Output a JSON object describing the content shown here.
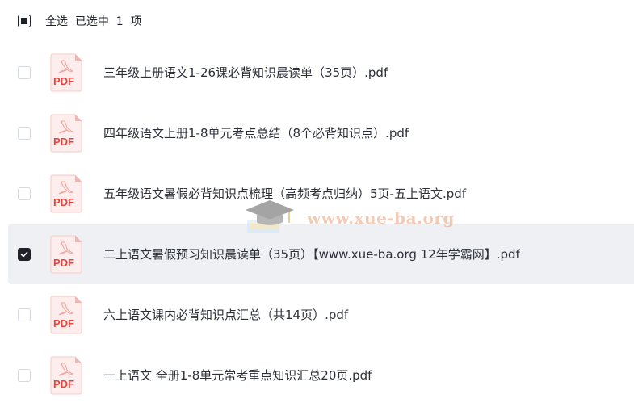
{
  "header": {
    "select_all_label": "全选  已选中  1  项"
  },
  "files": [
    {
      "name": "三年级上册语文1-26课必背知识晨读单（35页）.pdf",
      "selected": false,
      "icon": "pdf-icon"
    },
    {
      "name": "四年级语文上册1-8单元考点总结（8个必背知识点）.pdf",
      "selected": false,
      "icon": "pdf-icon"
    },
    {
      "name": "五年级语文暑假必背知识点梳理（高频考点归纳）5页-五上语文.pdf",
      "selected": false,
      "icon": "pdf-icon"
    },
    {
      "name": "二上语文暑假预习知识晨读单（35页）【www.xue-ba.org 12年学霸网】.pdf",
      "selected": true,
      "icon": "pdf-icon"
    },
    {
      "name": "六上语文课内必背知识点汇总（共14页）.pdf",
      "selected": false,
      "icon": "pdf-icon"
    },
    {
      "name": "一上语文 全册1-8单元常考重点知识汇总20页.pdf",
      "selected": false,
      "icon": "pdf-icon"
    }
  ],
  "pdf_icon_label": "PDF",
  "watermark": {
    "text": "www.xue-ba.org"
  },
  "colors": {
    "pdf_red": "#e5453d",
    "checked": "#1f2329",
    "selected_row": "#eef0f3"
  }
}
